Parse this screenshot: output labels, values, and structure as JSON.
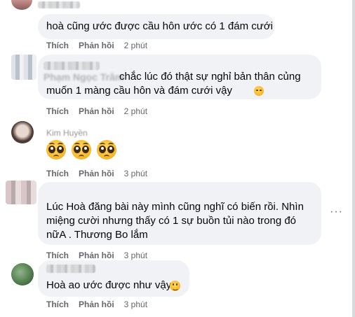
{
  "comments": [
    {
      "text_lines": [
        "hoà cũng ước được cầu hôn ước có 1 đám cưới"
      ],
      "actions": {
        "like": "Thích",
        "reply": "Phản hồi",
        "time": "2 phút"
      }
    },
    {
      "author_partial": "Phạm Ngọc Trâm",
      "text_lines": [
        "chắc lúc đó thật sự nghỉ bản thân củng",
        "muốn 1 màng cầu hôn và đám cưới vậy"
      ],
      "actions": {
        "like": "Thích",
        "reply": "Phản hồi",
        "time": "2 phút"
      }
    },
    {
      "author_partial": "Kim Huyền",
      "emojis": [
        "pleading-face",
        "pleading-face",
        "pleading-face"
      ],
      "actions": {
        "like": "Thích",
        "reply": "Phản hồi",
        "time": "3 phút"
      }
    },
    {
      "text_lines": [
        "Lúc Hoà đăng bài này mình cũng nghĩ có biến rồi. Nhìn",
        "miệng cười nhưng thấy có 1 sự buồn tủi nào trong đó",
        "nữA . Thương Bo lắm"
      ],
      "more": "···",
      "actions": {
        "like": "Thích",
        "reply": "Phản hồi",
        "time": "3 phút"
      }
    },
    {
      "text_lines": [
        "Hoà ao ước được như vậy"
      ],
      "emoji": "slightly-smiling-face",
      "actions": {
        "like": "Thích",
        "reply": "Phản hồi",
        "time": "3 phút"
      }
    }
  ]
}
